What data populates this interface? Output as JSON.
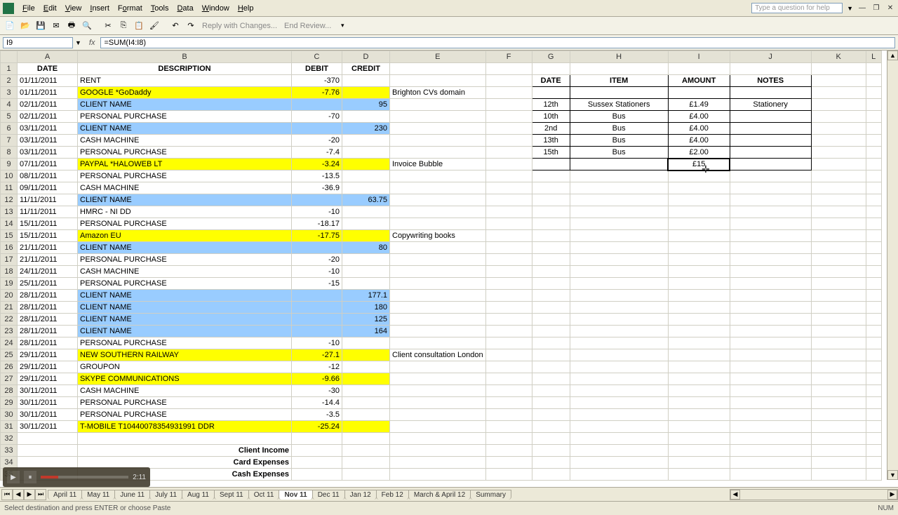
{
  "menu": {
    "file": "File",
    "edit": "Edit",
    "view": "View",
    "insert": "Insert",
    "format": "Format",
    "tools": "Tools",
    "data": "Data",
    "window": "Window",
    "help": "Help"
  },
  "help_placeholder": "Type a question for help",
  "toolbar": {
    "reply": "Reply with Changes...",
    "end_review": "End Review..."
  },
  "name_box": "I9",
  "formula": "=SUM(I4:I8)",
  "columns": [
    "A",
    "B",
    "C",
    "D",
    "E",
    "F",
    "G",
    "H",
    "I",
    "J",
    "K",
    "L"
  ],
  "headers": {
    "A": "DATE",
    "B": "DESCRIPTION",
    "C": "DEBIT",
    "D": "CREDIT"
  },
  "rows": [
    {
      "n": 1,
      "A": "DATE",
      "B": "DESCRIPTION",
      "C": "DEBIT",
      "D": "CREDIT",
      "hdr": true
    },
    {
      "n": 2,
      "A": "01/11/2011",
      "B": "RENT",
      "C": "-370"
    },
    {
      "n": 3,
      "A": "01/11/2011",
      "B": "GOOGLE *GoDaddy",
      "C": "-7.76",
      "E": "Brighton CVs domain",
      "cls": "yellow"
    },
    {
      "n": 4,
      "A": "02/11/2011",
      "B": "CLIENT NAME",
      "D": "95",
      "cls": "blue"
    },
    {
      "n": 5,
      "A": "02/11/2011",
      "B": "PERSONAL PURCHASE",
      "C": "-70"
    },
    {
      "n": 6,
      "A": "03/11/2011",
      "B": "CLIENT NAME",
      "D": "230",
      "cls": "blue"
    },
    {
      "n": 7,
      "A": "03/11/2011",
      "B": "CASH MACHINE",
      "C": "-20"
    },
    {
      "n": 8,
      "A": "03/11/2011",
      "B": "PERSONAL PURCHASE",
      "C": "-7.4"
    },
    {
      "n": 9,
      "A": "07/11/2011",
      "B": "PAYPAL *HALOWEB LT",
      "C": "-3.24",
      "E": "Invoice Bubble",
      "cls": "yellow"
    },
    {
      "n": 10,
      "A": "08/11/2011",
      "B": "PERSONAL PURCHASE",
      "C": "-13.5"
    },
    {
      "n": 11,
      "A": "09/11/2011",
      "B": "CASH MACHINE",
      "C": "-36.9"
    },
    {
      "n": 12,
      "A": "11/11/2011",
      "B": "CLIENT NAME",
      "D": "63.75",
      "cls": "blue"
    },
    {
      "n": 13,
      "A": "11/11/2011",
      "B": "HMRC - NI DD",
      "C": "-10"
    },
    {
      "n": 14,
      "A": "15/11/2011",
      "B": "PERSONAL PURCHASE",
      "C": "-18.17"
    },
    {
      "n": 15,
      "A": "15/11/2011",
      "B": "Amazon EU",
      "C": "-17.75",
      "E": "Copywriting books",
      "cls": "yellow"
    },
    {
      "n": 16,
      "A": "21/11/2011",
      "B": "CLIENT NAME",
      "D": "80",
      "cls": "blue"
    },
    {
      "n": 17,
      "A": "21/11/2011",
      "B": "PERSONAL PURCHASE",
      "C": "-20"
    },
    {
      "n": 18,
      "A": "24/11/2011",
      "B": "CASH MACHINE",
      "C": "-10"
    },
    {
      "n": 19,
      "A": "25/11/2011",
      "B": "PERSONAL PURCHASE",
      "C": "-15"
    },
    {
      "n": 20,
      "A": "28/11/2011",
      "B": "CLIENT NAME",
      "D": "177.1",
      "cls": "blue"
    },
    {
      "n": 21,
      "A": "28/11/2011",
      "B": "CLIENT NAME",
      "D": "180",
      "cls": "blue"
    },
    {
      "n": 22,
      "A": "28/11/2011",
      "B": "CLIENT NAME",
      "D": "125",
      "cls": "blue"
    },
    {
      "n": 23,
      "A": "28/11/2011",
      "B": "CLIENT NAME",
      "D": "164",
      "cls": "blue"
    },
    {
      "n": 24,
      "A": "28/11/2011",
      "B": "PERSONAL PURCHASE",
      "C": "-10"
    },
    {
      "n": 25,
      "A": "29/11/2011",
      "B": "NEW SOUTHERN RAILWAY",
      "C": "-27.1",
      "E": "Client consultation London",
      "cls": "yellow"
    },
    {
      "n": 26,
      "A": "29/11/2011",
      "B": "GROUPON",
      "C": "-12"
    },
    {
      "n": 27,
      "A": "29/11/2011",
      "B": "SKYPE COMMUNICATIONS",
      "C": "-9.66",
      "cls": "yellow"
    },
    {
      "n": 28,
      "A": "30/11/2011",
      "B": "CASH MACHINE",
      "C": "-30"
    },
    {
      "n": 29,
      "A": "30/11/2011",
      "B": "PERSONAL PURCHASE",
      "C": "-14.4"
    },
    {
      "n": 30,
      "A": "30/11/2011",
      "B": "PERSONAL PURCHASE",
      "C": "-3.5"
    },
    {
      "n": 31,
      "A": "30/11/2011",
      "B": "T-MOBILE          T10440078354931991 DDR",
      "C": "-25.24",
      "cls": "yellow"
    },
    {
      "n": 32
    },
    {
      "n": 33,
      "B": "Client Income",
      "bold": true,
      "right": true
    },
    {
      "n": 34,
      "B": "Card Expenses",
      "bold": true,
      "right": true
    },
    {
      "n": 35,
      "B": "Cash Expenses",
      "bold": true,
      "right": true
    }
  ],
  "side_table": {
    "headers": {
      "G": "DATE",
      "H": "ITEM",
      "I": "AMOUNT",
      "J": "NOTES"
    },
    "rows": [
      {
        "G": "12th",
        "H": "Sussex Stationers",
        "I": "£1.49",
        "J": "Stationery"
      },
      {
        "G": "10th",
        "H": "Bus",
        "I": "£4.00"
      },
      {
        "G": "2nd",
        "H": "Bus",
        "I": "£4.00"
      },
      {
        "G": "13th",
        "H": "Bus",
        "I": "£4.00"
      },
      {
        "G": "15th",
        "H": "Bus",
        "I": "£2.00"
      }
    ],
    "total_display": "£15"
  },
  "tabs": [
    "April 11",
    "May 11",
    "June 11",
    "July 11",
    "Aug 11",
    "Sept 11",
    "Oct 11",
    "Nov 11",
    "Dec 11",
    "Jan 12",
    "Feb 12",
    "March & April 12",
    "Summary"
  ],
  "active_tab": "Nov 11",
  "status": {
    "left": "Select destination and press ENTER or choose Paste",
    "num": "NUM"
  },
  "media_time": "2:11"
}
